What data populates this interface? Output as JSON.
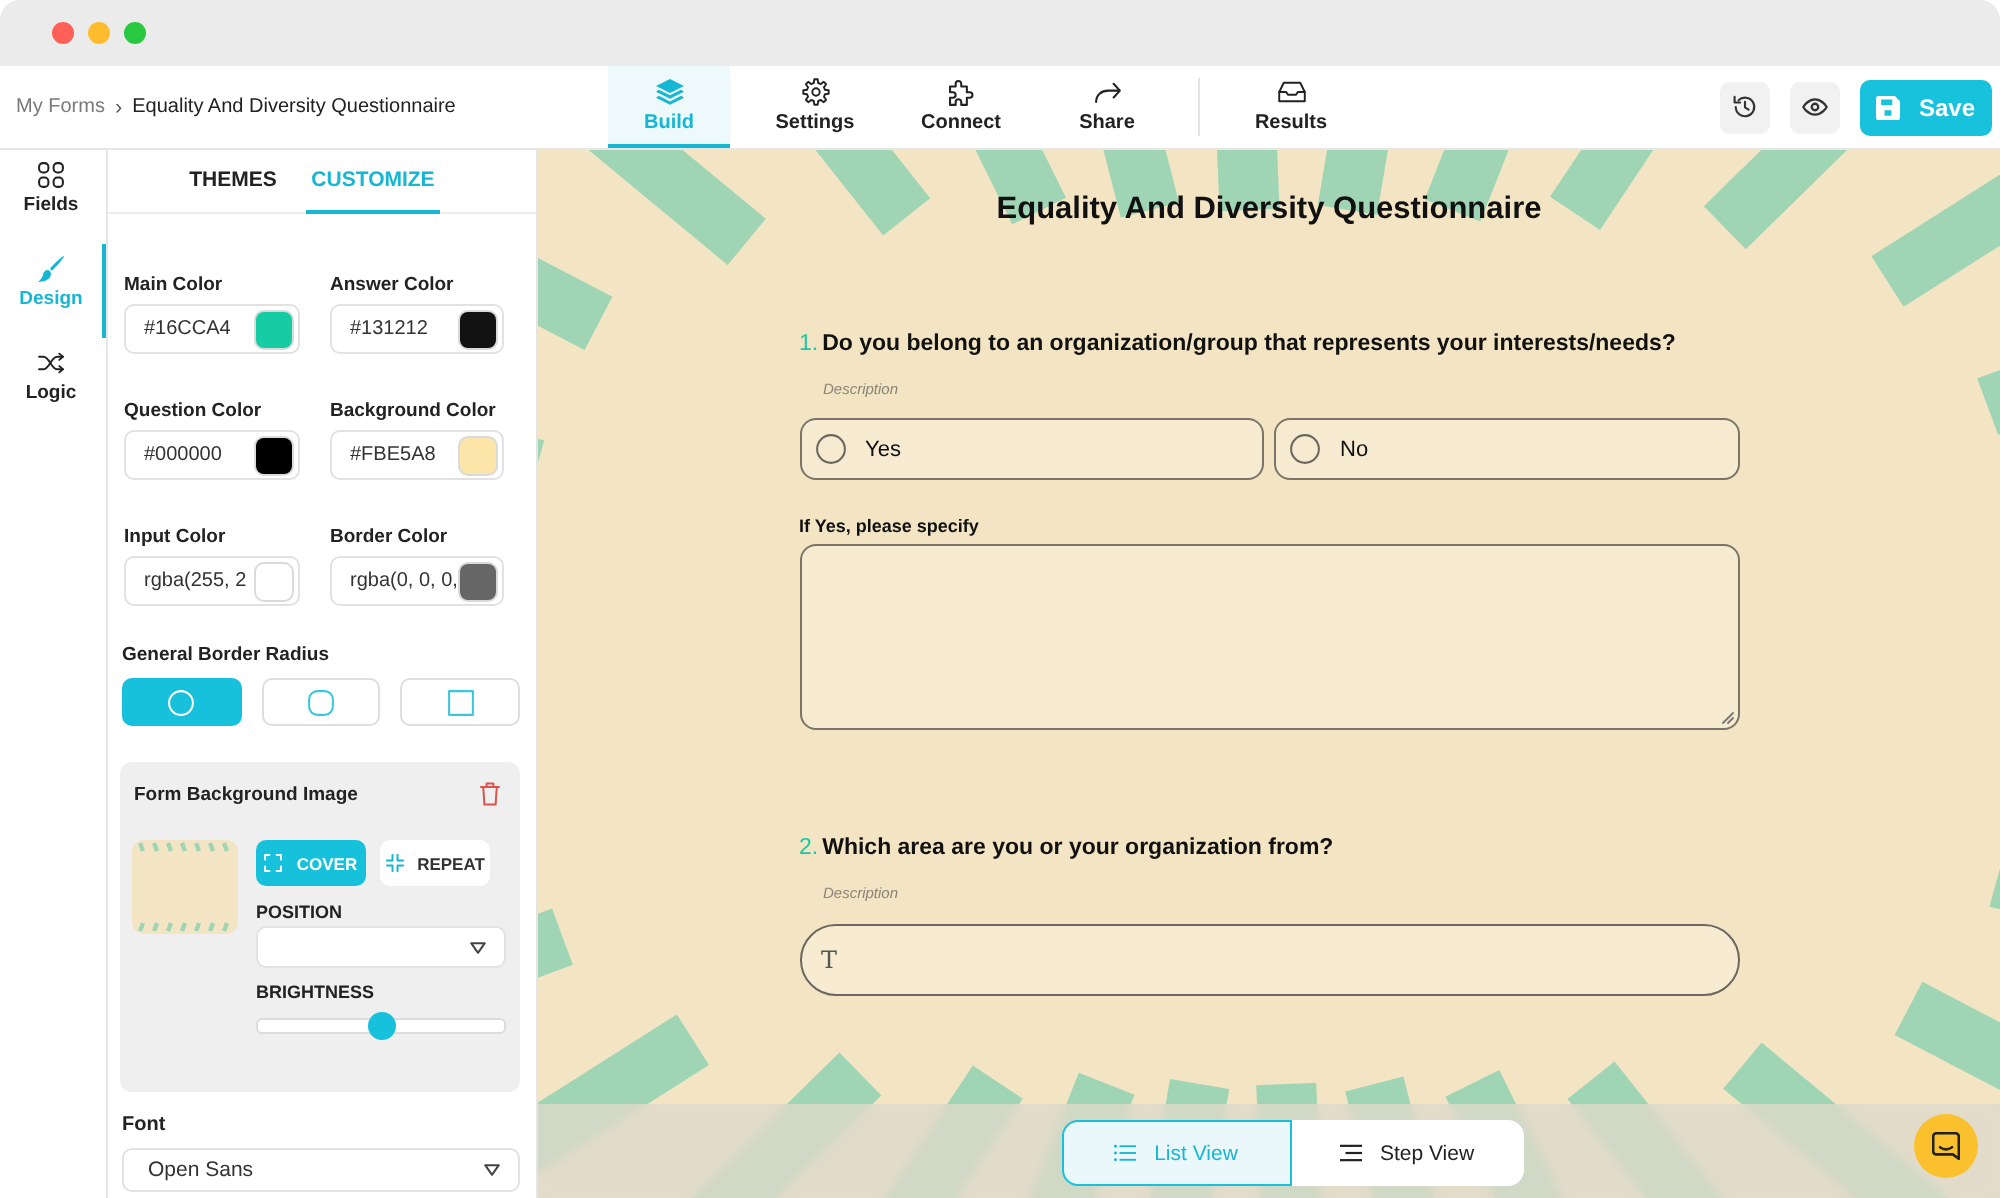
{
  "breadcrumb": {
    "items": [
      "My Forms",
      "Equality And Diversity Questionnaire"
    ],
    "separator": "›"
  },
  "nav_tabs": [
    {
      "label": "Build",
      "selected": true
    },
    {
      "label": "Settings",
      "selected": false
    },
    {
      "label": "Connect",
      "selected": false
    },
    {
      "label": "Share",
      "selected": false
    },
    {
      "label": "Results",
      "selected": false
    }
  ],
  "actions": {
    "save": "Save"
  },
  "rail": [
    {
      "label": "Fields",
      "selected": false
    },
    {
      "label": "Design",
      "selected": true
    },
    {
      "label": "Logic",
      "selected": false
    }
  ],
  "panel_tabs": [
    {
      "label": "THEMES",
      "selected": false
    },
    {
      "label": "CUSTOMIZE",
      "selected": true
    }
  ],
  "color_fields": [
    {
      "label": "Main Color",
      "value": "#16CCA4",
      "color": "#16cca4"
    },
    {
      "label": "Answer Color",
      "value": "#131212",
      "color": "#131212"
    },
    {
      "label": "Question Color",
      "value": "#000000",
      "color": "#000000"
    },
    {
      "label": "Background Color",
      "value": "#FBE5A8",
      "color": "#fbe5a8"
    },
    {
      "label": "Input Color",
      "value": "rgba(255, 2",
      "color": "#ffffff"
    },
    {
      "label": "Border Color",
      "value": "rgba(0, 0, 0,",
      "color": "#666666"
    }
  ],
  "border_radius": {
    "label": "General Border Radius",
    "options": [
      {
        "kind": "circle",
        "selected": true
      },
      {
        "kind": "rounded",
        "selected": false
      },
      {
        "kind": "square",
        "selected": false
      }
    ]
  },
  "background_image": {
    "title": "Form Background Image",
    "modes": [
      {
        "label": "COVER",
        "selected": true
      },
      {
        "label": "REPEAT",
        "selected": false
      }
    ],
    "position_label": "POSITION",
    "brightness_label": "BRIGHTNESS",
    "brightness": {
      "level": 0.5
    }
  },
  "font": {
    "label": "Font",
    "value": "Open Sans"
  },
  "form": {
    "title": "Equality And Diversity Questionnaire",
    "questions": [
      {
        "kind": "choice",
        "number": "1.",
        "text": "Do you belong to an organization/group that represents your interests/needs?",
        "description": "Description",
        "options": [
          {
            "label": "Yes",
            "selected": false
          },
          {
            "label": "No",
            "selected": false
          }
        ],
        "follow_up": {
          "label": "If Yes, please specify"
        }
      },
      {
        "kind": "text",
        "number": "2.",
        "text": "Which area are you or your organization from?",
        "description": "Description",
        "prefix": "T"
      }
    ]
  },
  "view_toggle": [
    {
      "label": "List View",
      "selected": true
    },
    {
      "label": "Step View",
      "selected": false
    }
  ]
}
